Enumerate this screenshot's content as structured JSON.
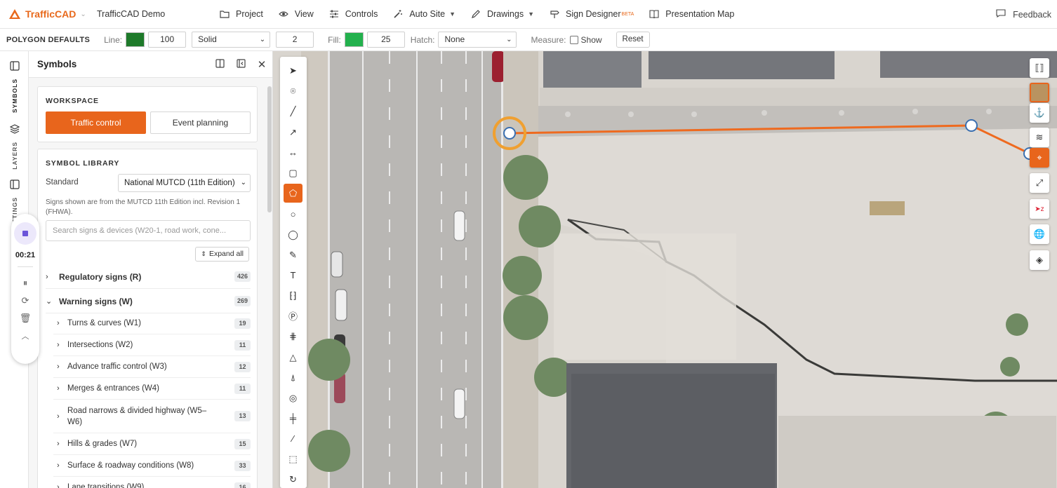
{
  "app": {
    "brand": "TrafficCAD",
    "project_name": "TrafficCAD Demo",
    "menu": [
      {
        "label": "Project",
        "icon": "folder-icon",
        "glyph": "🗀"
      },
      {
        "label": "View",
        "icon": "eye-icon",
        "glyph": "◉"
      },
      {
        "label": "Controls",
        "icon": "sliders-icon",
        "glyph": "☰"
      },
      {
        "label": "Auto Site",
        "icon": "magic-wand-icon",
        "glyph": "✦"
      },
      {
        "label": "Drawings",
        "icon": "pen-icon",
        "glyph": "✎"
      },
      {
        "label": "Sign Designer",
        "icon": "signpost-icon",
        "glyph": "⊸",
        "badge": "BETA"
      },
      {
        "label": "Presentation Map",
        "icon": "book-icon",
        "glyph": "▯"
      }
    ],
    "feedback": "Feedback"
  },
  "polygon_defaults": {
    "label": "POLYGON DEFAULTS",
    "line_label": "Line:",
    "line_color": "#1e7a2a",
    "line_opacity": "100",
    "line_style": "Solid",
    "line_width": "2",
    "fill_label": "Fill:",
    "fill_color": "#23b14d",
    "fill_opacity": "25",
    "hatch_label": "Hatch:",
    "hatch_value": "None",
    "measure_label": "Measure:",
    "show_label": "Show",
    "reset_label": "Reset"
  },
  "rail": {
    "tabs": [
      "SYMBOLS",
      "LAYERS",
      "SETTINGS"
    ]
  },
  "recorder": {
    "time": "00:21"
  },
  "symbols": {
    "title": "Symbols",
    "workspace": {
      "title": "WORKSPACE",
      "traffic_control": "Traffic control",
      "event_planning": "Event planning"
    },
    "library": {
      "title": "SYMBOL LIBRARY",
      "standard_label": "Standard",
      "standard_value": "National MUTCD (11th Edition)",
      "note": "Signs shown are from the MUTCD 11th Edition incl. Revision 1 (FHWA).",
      "search_placeholder": "Search signs & devices (W20-1, road work, cone...",
      "expand_all": "Expand all",
      "categories": [
        {
          "label": "Regulatory signs (R)",
          "count": "426"
        },
        {
          "label": "Warning signs (W)",
          "count": "269"
        }
      ],
      "subcategories": [
        {
          "label": "Turns & curves (W1)",
          "count": "19"
        },
        {
          "label": "Intersections (W2)",
          "count": "11"
        },
        {
          "label": "Advance traffic control (W3)",
          "count": "12"
        },
        {
          "label": "Merges & entrances (W4)",
          "count": "11"
        },
        {
          "label": "Road narrows & divided highway (W5–W6)",
          "count": "13"
        },
        {
          "label": "Hills & grades (W7)",
          "count": "15"
        },
        {
          "label": "Surface & roadway conditions (W8)",
          "count": "33"
        },
        {
          "label": "Lane transitions (W9)",
          "count": "16"
        }
      ]
    }
  },
  "colors": {
    "accent": "#e8651c",
    "polygon_line": "#ee6a1f"
  }
}
